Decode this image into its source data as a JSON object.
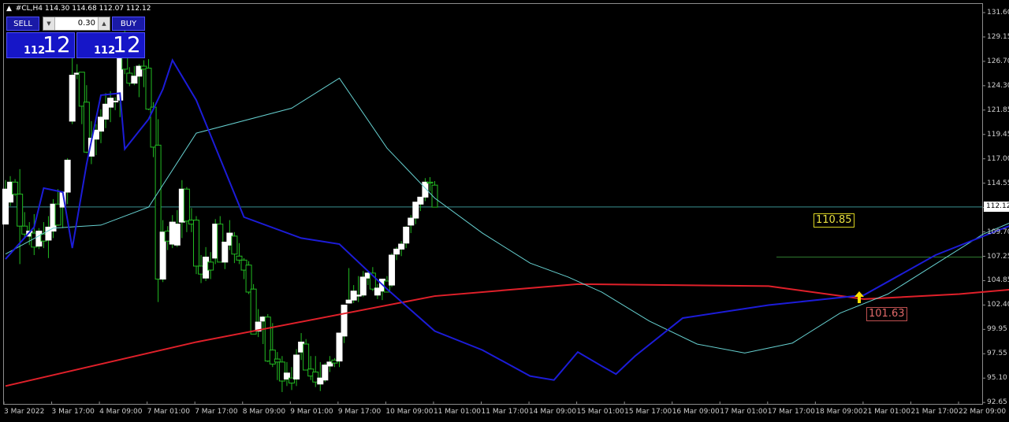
{
  "window": {
    "symbol": "#CL,H4",
    "ohlc": "114.30 114.68 112.07 112.12"
  },
  "trade_panel": {
    "sell_label": "SELL",
    "buy_label": "BUY",
    "lot": "0.30",
    "sell_price_small": "112",
    "sell_price_big": "12",
    "buy_price_small": "112",
    "buy_price_big": "12"
  },
  "annotations": {
    "high_label": "110.85",
    "low_label": "101.63",
    "current_price": "112.12"
  },
  "colors": {
    "background": "#000000",
    "bull_candle": "#ffffff",
    "wick": "#22bb22",
    "ma_slow": "#e0202a",
    "ma_fast": "#1c1cd8",
    "ma_signal": "#66d0d0",
    "arrow": "#ffe000"
  },
  "chart_data": {
    "type": "candlestick",
    "symbol": "#CL,H4",
    "y_axis": [
      "131.60",
      "129.15",
      "126.70",
      "124.30",
      "121.85",
      "119.45",
      "117.00",
      "114.55",
      "112.12",
      "109.70",
      "107.25",
      "104.85",
      "102.40",
      "99.95",
      "97.55",
      "95.10",
      "92.65"
    ],
    "x_axis": [
      "3 Mar 2022",
      "3 Mar 17:00",
      "4 Mar 09:00",
      "7 Mar 01:00",
      "7 Mar 17:00",
      "8 Mar 09:00",
      "9 Mar 01:00",
      "9 Mar 17:00",
      "10 Mar 09:00",
      "11 Mar 01:00",
      "11 Mar 17:00",
      "14 Mar 09:00",
      "15 Mar 01:00",
      "15 Mar 17:00",
      "16 Mar 09:00",
      "17 Mar 01:00",
      "17 Mar 17:00",
      "18 Mar 09:00",
      "21 Mar 01:00",
      "21 Mar 17:00",
      "22 Mar 09:00"
    ],
    "ylim": [
      92.65,
      131.6
    ],
    "candles": [
      [
        110.4,
        114.8,
        111.8,
        113.9
      ],
      [
        112.6,
        115.2,
        112.2,
        114.6
      ],
      [
        114.6,
        114.9,
        113.2,
        113.4
      ],
      [
        113.4,
        115.9,
        106.4,
        110.2
      ],
      [
        110.2,
        111.6,
        109.0,
        109.4
      ],
      [
        109.2,
        110.6,
        108.3,
        109.7
      ],
      [
        109.5,
        111.4,
        107.3,
        108.1
      ],
      [
        108.2,
        110.0,
        107.9,
        109.7
      ],
      [
        109.4,
        110.6,
        108.0,
        108.7
      ],
      [
        108.8,
        111.2,
        107.0,
        110.1
      ],
      [
        109.7,
        112.9,
        109.0,
        112.4
      ],
      [
        112.4,
        113.9,
        110.2,
        110.3
      ],
      [
        112.1,
        113.7,
        110.0,
        113.6
      ],
      [
        113.6,
        117.0,
        112.4,
        116.8
      ],
      [
        120.7,
        127.2,
        120.4,
        125.3
      ],
      [
        125.4,
        126.4,
        124.9,
        125.5
      ],
      [
        125.6,
        125.6,
        120.4,
        122.2
      ],
      [
        122.6,
        124.3,
        117.5,
        117.6
      ],
      [
        117.2,
        120.7,
        116.4,
        119.0
      ],
      [
        118.9,
        120.4,
        117.3,
        119.8
      ],
      [
        119.7,
        121.9,
        118.5,
        121.1
      ],
      [
        120.9,
        123.5,
        120.0,
        122.4
      ],
      [
        122.1,
        123.7,
        120.6,
        123.0
      ],
      [
        122.7,
        123.1,
        121.8,
        122.7
      ],
      [
        122.8,
        129.4,
        121.1,
        128.8
      ],
      [
        128.8,
        130.0,
        125.4,
        125.9
      ],
      [
        125.5,
        126.1,
        124.2,
        124.5
      ],
      [
        124.5,
        126.2,
        124.3,
        125.2
      ],
      [
        125.2,
        126.4,
        123.1,
        126.2
      ],
      [
        126.2,
        126.8,
        124.1,
        125.9
      ],
      [
        126.0,
        126.9,
        121.8,
        121.9
      ],
      [
        122.1,
        122.6,
        117.1,
        118.1
      ],
      [
        118.3,
        120.9,
        102.6,
        104.9
      ],
      [
        104.9,
        110.8,
        104.6,
        109.6
      ],
      [
        109.7,
        110.2,
        107.8,
        108.7
      ],
      [
        108.4,
        111.3,
        108.0,
        110.6
      ],
      [
        108.3,
        111.8,
        108.1,
        110.4
      ],
      [
        110.6,
        114.8,
        109.0,
        113.9
      ],
      [
        113.9,
        114.1,
        109.6,
        110.7
      ],
      [
        110.8,
        112.0,
        109.6,
        110.4
      ],
      [
        110.8,
        111.2,
        105.4,
        106.2
      ],
      [
        106.2,
        107.3,
        104.5,
        105.4
      ],
      [
        105.0,
        108.1,
        104.7,
        107.1
      ],
      [
        106.6,
        107.6,
        104.9,
        105.8
      ],
      [
        107.0,
        110.9,
        106.4,
        110.4
      ],
      [
        110.4,
        111.2,
        107.0,
        106.6
      ],
      [
        106.6,
        108.6,
        105.9,
        108.6
      ],
      [
        108.3,
        110.8,
        107.8,
        109.5
      ],
      [
        109.2,
        109.6,
        106.5,
        107.4
      ],
      [
        107.2,
        108.5,
        106.4,
        106.8
      ],
      [
        106.8,
        107.0,
        104.9,
        105.8
      ],
      [
        106.3,
        106.7,
        103.4,
        103.6
      ],
      [
        103.9,
        104.4,
        99.4,
        99.4
      ],
      [
        99.7,
        101.9,
        99.1,
        100.6
      ],
      [
        100.7,
        101.2,
        98.4,
        101.1
      ],
      [
        101.1,
        101.4,
        96.6,
        96.7
      ],
      [
        97.8,
        100.5,
        96.1,
        96.4
      ],
      [
        96.9,
        97.6,
        94.8,
        96.6
      ],
      [
        96.6,
        97.2,
        93.6,
        94.7
      ],
      [
        94.9,
        96.6,
        94.2,
        95.5
      ],
      [
        95.0,
        96.1,
        93.8,
        94.5
      ],
      [
        94.9,
        97.9,
        94.2,
        97.3
      ],
      [
        97.6,
        99.5,
        96.8,
        98.6
      ],
      [
        98.4,
        98.9,
        95.9,
        95.8
      ],
      [
        95.9,
        97.2,
        94.8,
        95.2
      ],
      [
        95.6,
        97.2,
        94.1,
        94.6
      ],
      [
        94.4,
        96.6,
        93.7,
        95.0
      ],
      [
        94.8,
        96.5,
        94.6,
        96.3
      ],
      [
        96.2,
        97.2,
        95.6,
        96.6
      ],
      [
        96.8,
        97.0,
        96.1,
        96.5
      ],
      [
        96.7,
        98.3,
        96.1,
        99.5
      ],
      [
        99.2,
        100.4,
        98.5,
        102.3
      ],
      [
        102.5,
        106.0,
        102.5,
        102.8
      ],
      [
        102.8,
        104.3,
        102.5,
        103.7
      ],
      [
        103.2,
        105.2,
        102.6,
        103.3
      ],
      [
        103.3,
        105.7,
        103.1,
        105.1
      ],
      [
        105.0,
        105.6,
        104.3,
        105.5
      ],
      [
        105.5,
        106.1,
        103.7,
        103.9
      ],
      [
        103.3,
        104.4,
        102.9,
        104.0
      ],
      [
        103.7,
        104.2,
        102.8,
        104.9
      ],
      [
        104.7,
        105.2,
        103.7,
        103.6
      ],
      [
        104.3,
        107.5,
        104.1,
        107.3
      ],
      [
        107.4,
        108.1,
        106.8,
        107.9
      ],
      [
        107.9,
        108.7,
        107.2,
        108.4
      ],
      [
        108.5,
        110.2,
        108.0,
        110.1
      ],
      [
        110.3,
        111.3,
        109.5,
        111.0
      ],
      [
        111.0,
        112.5,
        110.4,
        112.6
      ],
      [
        112.4,
        113.0,
        111.7,
        113.1
      ],
      [
        113.1,
        115.0,
        112.7,
        114.6
      ],
      [
        114.6,
        115.1,
        113.7,
        114.5
      ],
      [
        114.3,
        114.7,
        112.1,
        112.1
      ]
    ],
    "ma_slow": [
      [
        0,
        94.2
      ],
      [
        40,
        98.6
      ],
      [
        90,
        103.2
      ],
      [
        120,
        104.4
      ],
      [
        160,
        104.2
      ],
      [
        180,
        102.9
      ],
      [
        200,
        103.4
      ],
      [
        212,
        103.9
      ]
    ],
    "ma_fast": [
      [
        0,
        106.9
      ],
      [
        6,
        110.1
      ],
      [
        8,
        114.0
      ],
      [
        12,
        113.6
      ],
      [
        14,
        108.0
      ],
      [
        17,
        116.4
      ],
      [
        20,
        123.3
      ],
      [
        24,
        123.5
      ],
      [
        25,
        117.9
      ],
      [
        30,
        120.9
      ],
      [
        33,
        123.9
      ],
      [
        35,
        126.8
      ],
      [
        40,
        122.8
      ],
      [
        50,
        111.1
      ],
      [
        62,
        109.0
      ],
      [
        70,
        108.4
      ],
      [
        80,
        103.9
      ],
      [
        90,
        99.7
      ],
      [
        100,
        97.8
      ],
      [
        110,
        95.2
      ],
      [
        115,
        94.8
      ],
      [
        120,
        97.6
      ],
      [
        125,
        96.2
      ],
      [
        128,
        95.4
      ],
      [
        132,
        97.2
      ],
      [
        142,
        101.0
      ],
      [
        160,
        102.3
      ],
      [
        180,
        103.3
      ],
      [
        195,
        107.3
      ],
      [
        212,
        110.5
      ]
    ],
    "ma_signal": [
      [
        0,
        107.4
      ],
      [
        10,
        110.0
      ],
      [
        20,
        110.3
      ],
      [
        30,
        112.1
      ],
      [
        40,
        119.5
      ],
      [
        60,
        122.0
      ],
      [
        70,
        125.0
      ],
      [
        80,
        118.0
      ],
      [
        90,
        113.0
      ],
      [
        100,
        109.5
      ],
      [
        110,
        106.5
      ],
      [
        118,
        105.1
      ],
      [
        125,
        103.6
      ],
      [
        135,
        100.7
      ],
      [
        145,
        98.4
      ],
      [
        155,
        97.5
      ],
      [
        165,
        98.5
      ],
      [
        175,
        101.5
      ],
      [
        185,
        103.4
      ],
      [
        195,
        106.4
      ],
      [
        205,
        109.4
      ],
      [
        212,
        110.8
      ]
    ],
    "horizontal_lines": [
      112.12,
      107.1
    ],
    "arrow_up": 103.2
  }
}
